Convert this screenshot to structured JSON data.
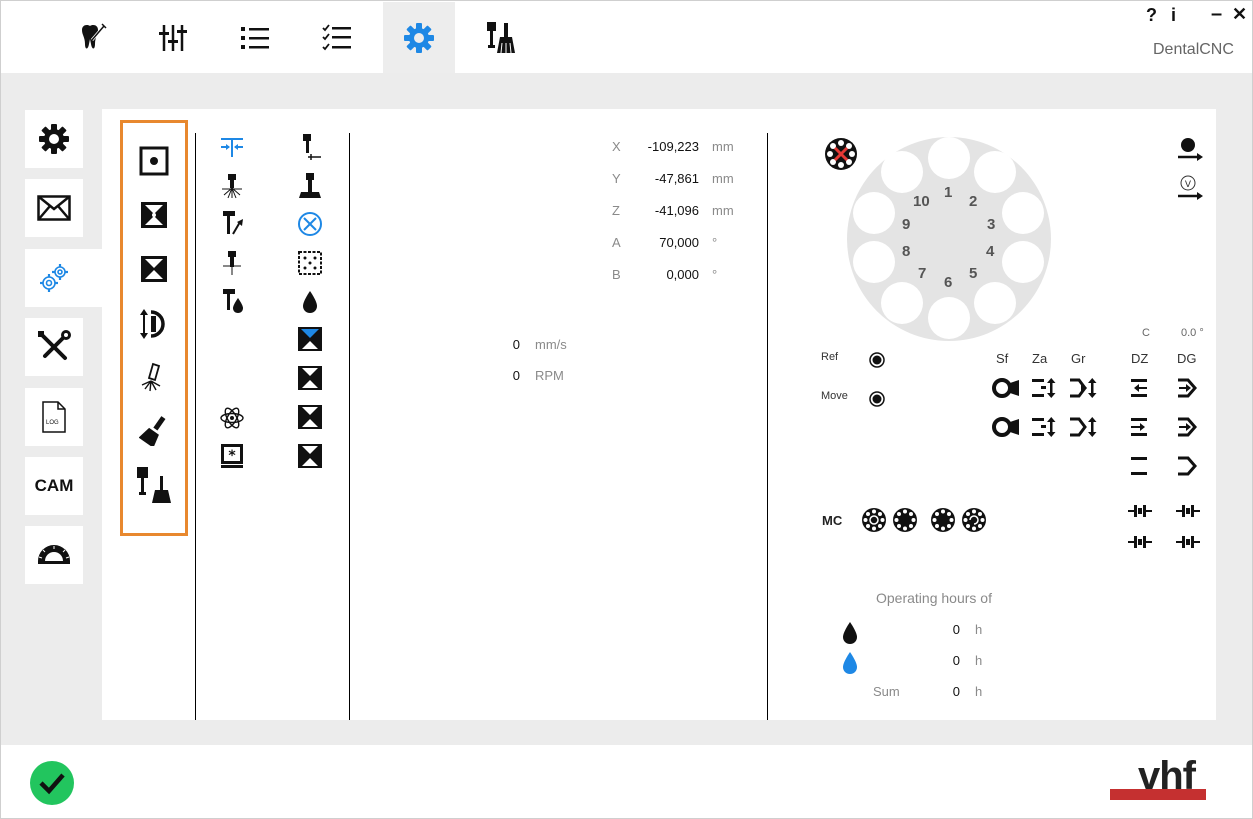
{
  "app": {
    "name": "DentalCNC",
    "help": "?",
    "info": "i",
    "minimize": "–",
    "close": "✕"
  },
  "top_tabs": [
    {
      "icon": "tooth-tool-icon"
    },
    {
      "icon": "sliders-icon"
    },
    {
      "icon": "list-icon"
    },
    {
      "icon": "checklist-icon"
    },
    {
      "icon": "gear-icon",
      "active": true
    },
    {
      "icon": "tools-brush-icon"
    }
  ],
  "sidebar": {
    "items": [
      {
        "icon": "gear-icon"
      },
      {
        "icon": "envelope-icon"
      },
      {
        "icon": "gears-icon",
        "active": true
      },
      {
        "icon": "wrench-screwdriver-icon"
      },
      {
        "icon": "log-file-icon",
        "label": "LOG"
      },
      {
        "icon": "cam-icon",
        "label": "CAM"
      },
      {
        "icon": "protractor-icon"
      }
    ]
  },
  "highlight_color": "#e8882e",
  "accent_color": "#1e88e5",
  "positions": [
    {
      "axis": "X",
      "value": "-109,223",
      "unit": "mm"
    },
    {
      "axis": "Y",
      "value": "-47,861",
      "unit": "mm"
    },
    {
      "axis": "Z",
      "value": "-41,096",
      "unit": "mm"
    },
    {
      "axis": "A",
      "value": "70,000",
      "unit": "°"
    },
    {
      "axis": "B",
      "value": "0,000",
      "unit": "°"
    }
  ],
  "feed": {
    "value": "0",
    "unit": "mm/s"
  },
  "spindle": {
    "value": "0",
    "unit": "RPM"
  },
  "tool_changer": {
    "numbers": [
      "1",
      "2",
      "3",
      "4",
      "5",
      "6",
      "7",
      "8",
      "9",
      "10"
    ]
  },
  "c_axis": {
    "label": "C",
    "value": "0.0 °"
  },
  "controls": {
    "ref_label": "Ref",
    "move_label": "Move",
    "col_sf": "Sf",
    "col_za": "Za",
    "col_gr": "Gr",
    "col_dz": "DZ",
    "col_dg": "DG",
    "mc_label": "MC"
  },
  "hours": {
    "title": "Operating hours of",
    "rows": [
      {
        "icon": "black-drop-icon",
        "value": "0",
        "unit": "h"
      },
      {
        "icon": "blue-drop-icon",
        "value": "0",
        "unit": "h"
      },
      {
        "label": "Sum",
        "value": "0",
        "unit": "h"
      }
    ]
  },
  "footer": {
    "status": "ok",
    "brand": "vhf"
  }
}
